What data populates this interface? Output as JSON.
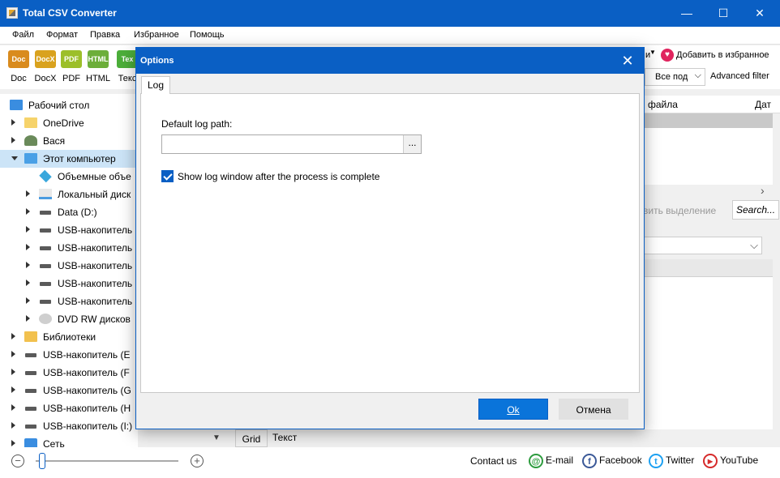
{
  "window": {
    "title": "Total CSV Converter",
    "controls": {
      "minimize": "—",
      "maximize": "☐",
      "close": "✕"
    }
  },
  "menu": [
    "Файл",
    "Формат",
    "Правка",
    "Избранное",
    "Помощь"
  ],
  "toolbar": {
    "formats": [
      {
        "label": "Doc",
        "icon_text": "Doc",
        "color": "#d98b1e"
      },
      {
        "label": "DocX",
        "icon_text": "DocX",
        "color": "#d9a21e"
      },
      {
        "label": "PDF",
        "icon_text": "PDF",
        "color": "#9cbf2a"
      },
      {
        "label": "HTML",
        "icon_text": "HTML",
        "color": "#6cae3a"
      },
      {
        "label": "Текс",
        "icon_text": "Tex",
        "color": "#4cae3a"
      }
    ],
    "dropdown_arrow_label": "и",
    "add_favorite": "Добавить в избранное",
    "filter_select": "Все под",
    "advanced_filter": "Advanced filter"
  },
  "tree": [
    {
      "label": "Рабочий стол",
      "icon": "desktop-icon",
      "indent": 0,
      "arrow": "none"
    },
    {
      "label": "OneDrive",
      "icon": "folder-icon",
      "indent": 1,
      "arrow": "right"
    },
    {
      "label": "Вася",
      "icon": "user-icon",
      "indent": 1,
      "arrow": "right"
    },
    {
      "label": "Этот компьютер",
      "icon": "computer-icon",
      "indent": 1,
      "arrow": "down",
      "selected": true
    },
    {
      "label": "Объемные объе",
      "icon": "3d-objects-icon",
      "indent": 2,
      "arrow": "none"
    },
    {
      "label": "Локальный диск",
      "icon": "windows-drive-icon",
      "indent": 2,
      "arrow": "right"
    },
    {
      "label": "Data (D:)",
      "icon": "drive-icon",
      "indent": 2,
      "arrow": "right"
    },
    {
      "label": "USB-накопитель",
      "icon": "drive-icon",
      "indent": 2,
      "arrow": "right"
    },
    {
      "label": "USB-накопитель",
      "icon": "drive-icon",
      "indent": 2,
      "arrow": "right"
    },
    {
      "label": "USB-накопитель",
      "icon": "drive-icon",
      "indent": 2,
      "arrow": "right"
    },
    {
      "label": "USB-накопитель",
      "icon": "drive-icon",
      "indent": 2,
      "arrow": "right"
    },
    {
      "label": "USB-накопитель",
      "icon": "drive-icon",
      "indent": 2,
      "arrow": "right"
    },
    {
      "label": "DVD RW дисков",
      "icon": "dvd-icon",
      "indent": 2,
      "arrow": "right"
    },
    {
      "label": "Библиотеки",
      "icon": "library-icon",
      "indent": 1,
      "arrow": "right"
    },
    {
      "label": "USB-накопитель (E",
      "icon": "drive-icon",
      "indent": 1,
      "arrow": "right"
    },
    {
      "label": "USB-накопитель (F",
      "icon": "drive-icon",
      "indent": 1,
      "arrow": "right"
    },
    {
      "label": "USB-накопитель (G",
      "icon": "drive-icon",
      "indent": 1,
      "arrow": "right"
    },
    {
      "label": "USB-накопитель (H",
      "icon": "drive-icon",
      "indent": 1,
      "arrow": "right"
    },
    {
      "label": "USB-накопитель (I:)",
      "icon": "drive-icon",
      "indent": 1,
      "arrow": "right"
    },
    {
      "label": "Сеть",
      "icon": "network-icon",
      "indent": 1,
      "arrow": "right"
    }
  ],
  "right_panel": {
    "col_file": "файла",
    "col_date": "Дат",
    "select_all": "вить выделение",
    "search_placeholder": "Search..."
  },
  "bottom": {
    "grid_tab": "Grid",
    "text_tab": "Текст",
    "zoom_level": 0.25,
    "contact_us": "Contact us",
    "social": [
      {
        "label": "E-mail",
        "icon": "email-icon",
        "color": "#2e9c3f",
        "glyph": "@"
      },
      {
        "label": "Facebook",
        "icon": "facebook-icon",
        "color": "#3b5998",
        "glyph": "f"
      },
      {
        "label": "Twitter",
        "icon": "twitter-icon",
        "color": "#1da1f2",
        "glyph": "t"
      },
      {
        "label": "YouTube",
        "icon": "youtube-icon",
        "color": "#d62b2b",
        "glyph": "▶"
      }
    ]
  },
  "dialog": {
    "title": "Options",
    "tab": "Log",
    "default_log_path_label": "Default log path:",
    "default_log_path_value": "",
    "browse": "...",
    "show_log_label": "Show log window after the process is complete",
    "show_log_checked": true,
    "ok": "Ok",
    "cancel": "Отмена"
  }
}
